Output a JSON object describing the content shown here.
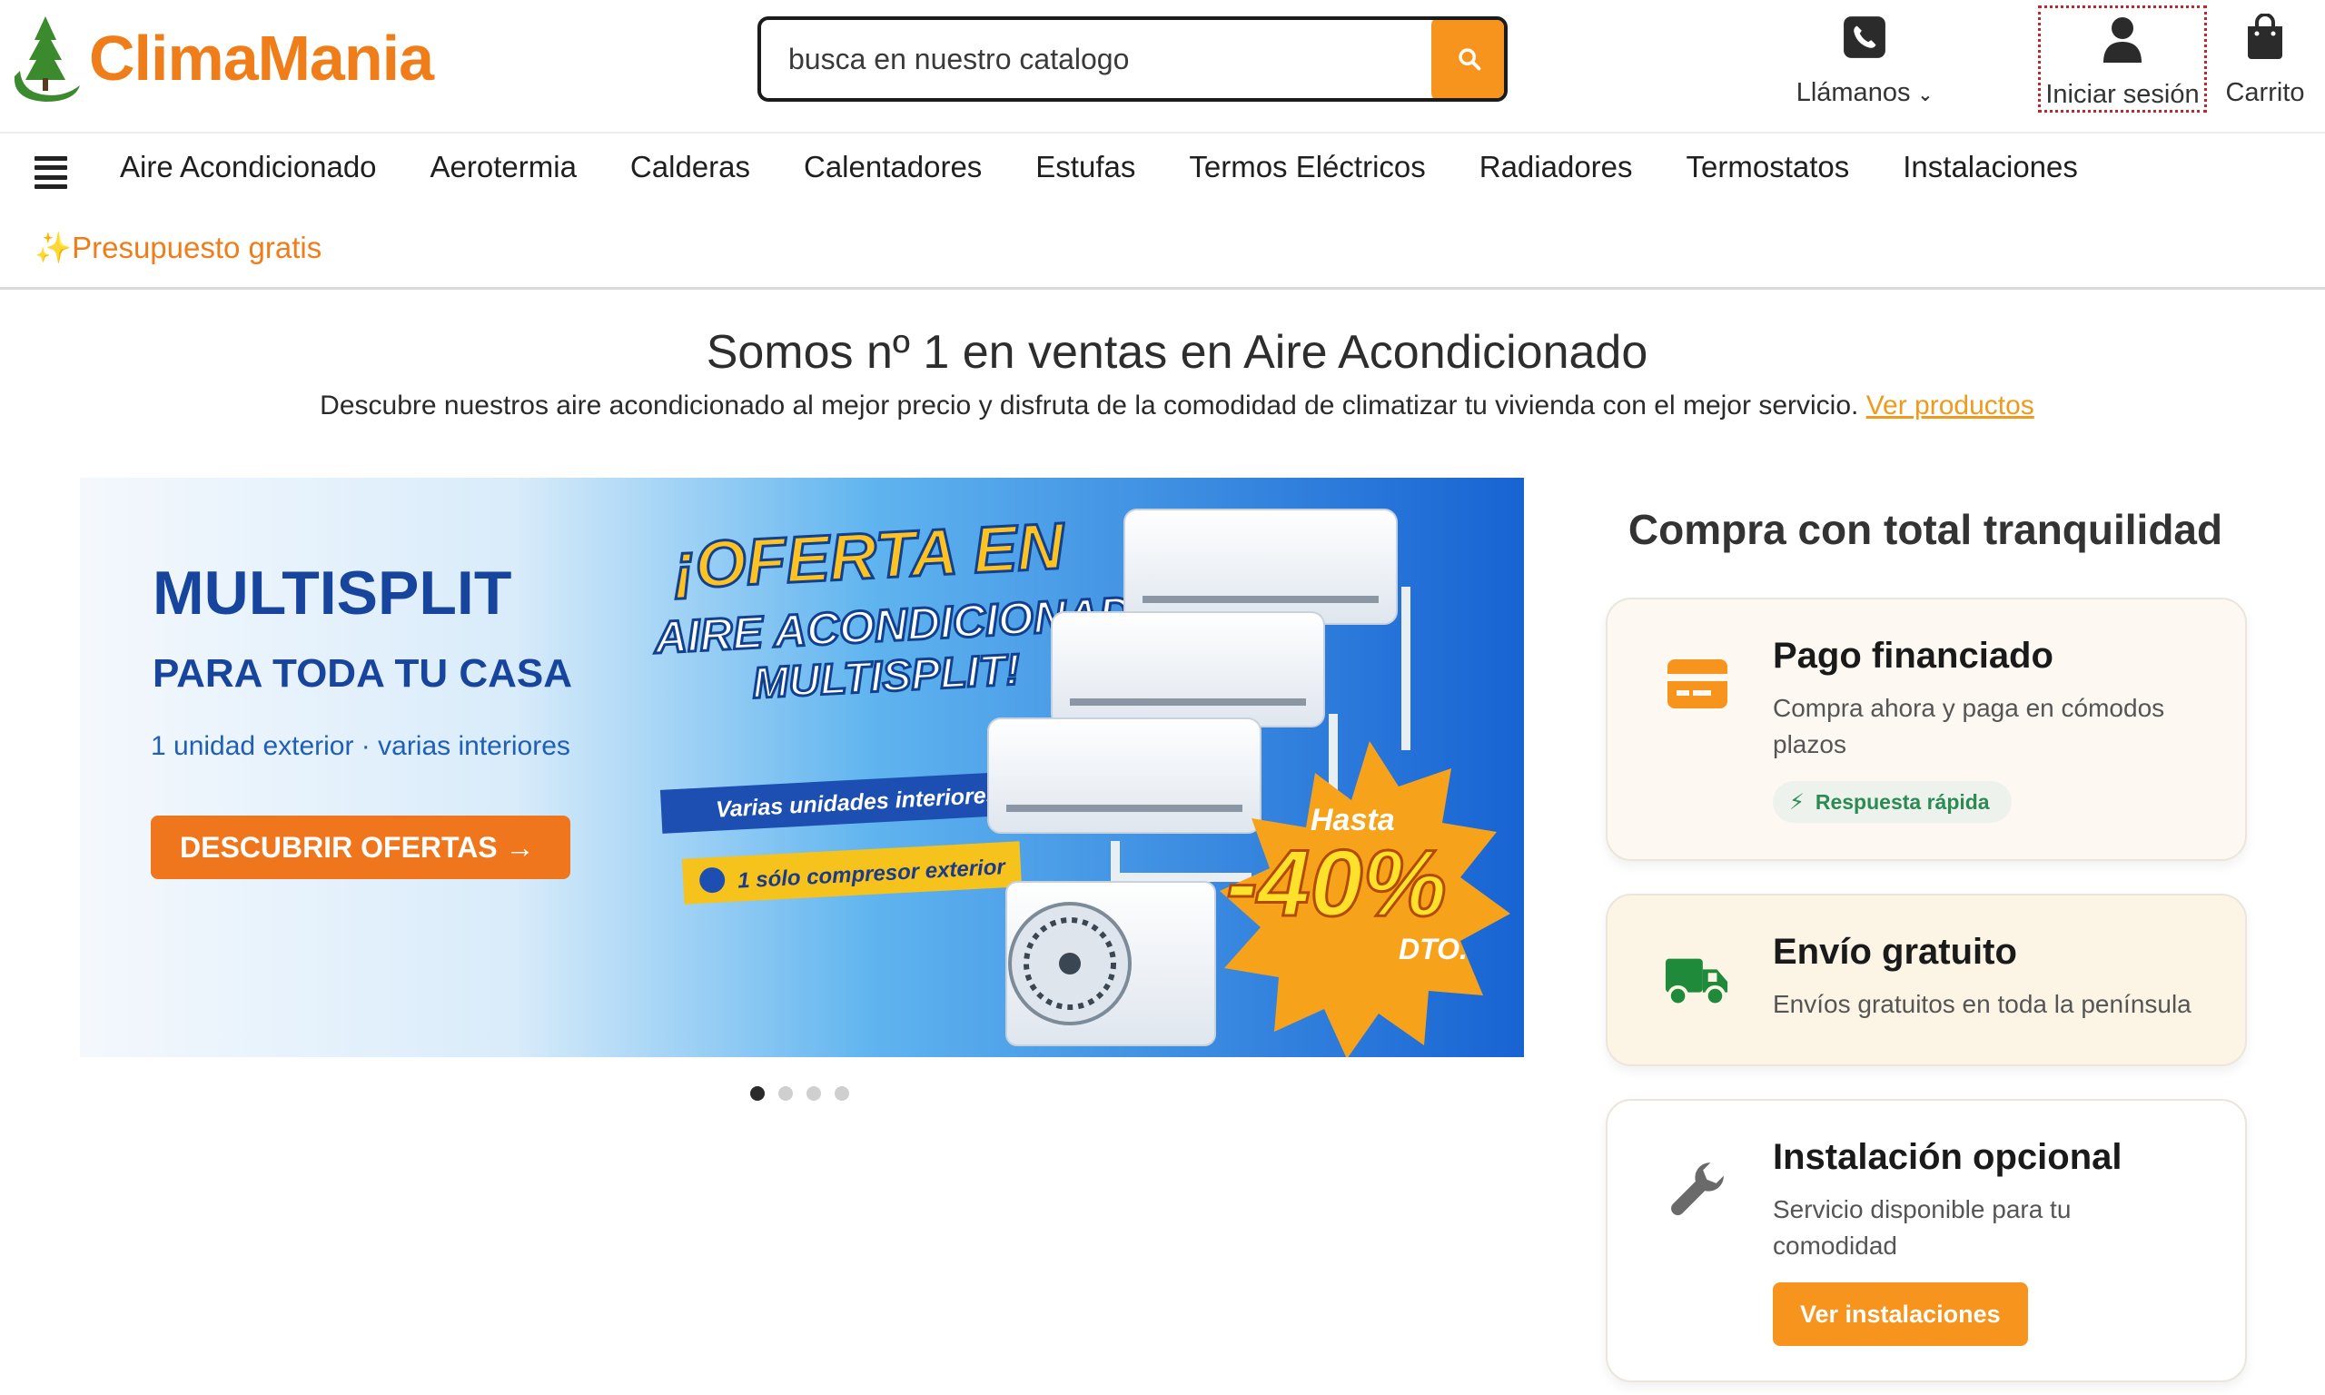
{
  "header": {
    "logo_text": "ClimaMania",
    "search_placeholder": "busca en nuestro catalogo",
    "call_label": "Llámanos",
    "login_label": "Iniciar sesión",
    "cart_label": "Carrito"
  },
  "nav": {
    "items": [
      "Aire Acondicionado",
      "Aerotermia",
      "Calderas",
      "Calentadores",
      "Estufas",
      "Termos Eléctricos",
      "Radiadores",
      "Termostatos",
      "Instalaciones"
    ],
    "promo": "✨Presupuesto gratis"
  },
  "hero": {
    "title": "Somos nº 1 en ventas en Aire Acondicionado",
    "subtitle": "Descubre nuestros aire acondicionado al mejor precio y disfruta de la comodidad de climatizar tu vivienda con el mejor servicio.",
    "link": "Ver productos"
  },
  "banner": {
    "headline1": "MULTISPLIT",
    "headline2": "PARA TODA TU CASA",
    "tagline": "1 unidad exterior · varias interiores",
    "cta": "DESCUBRIR OFERTAS →",
    "offer1": "¡OFERTA EN",
    "offer2": "AIRE ACONDICIONADO",
    "offer3": "MULTISPLIT!",
    "feature1": "Varias unidades interiores",
    "feature2": "1 sólo compresor exterior",
    "badge_top": "Hasta",
    "badge_pct": "-40%",
    "badge_bottom": "DTO.",
    "slides": 4,
    "active_slide": 1
  },
  "side": {
    "title": "Compra con total tranquilidad",
    "cards": [
      {
        "title": "Pago financiado",
        "desc": "Compra ahora y paga en cómodos plazos",
        "badge": "Respuesta rápida",
        "icon": "credit-card-icon"
      },
      {
        "title": "Envío gratuito",
        "desc": "Envíos gratuitos en toda la península",
        "icon": "truck-icon"
      },
      {
        "title": "Instalación opcional",
        "desc": "Servicio disponible para tu comodidad",
        "button": "Ver instalaciones",
        "icon": "wrench-icon"
      }
    ]
  },
  "colors": {
    "brand_orange": "#f7941d",
    "logo_orange": "#ef7d1a",
    "logo_green": "#3b8a2e",
    "truck_green": "#1e8a3a",
    "banner_blue": "#1f6fd8"
  }
}
